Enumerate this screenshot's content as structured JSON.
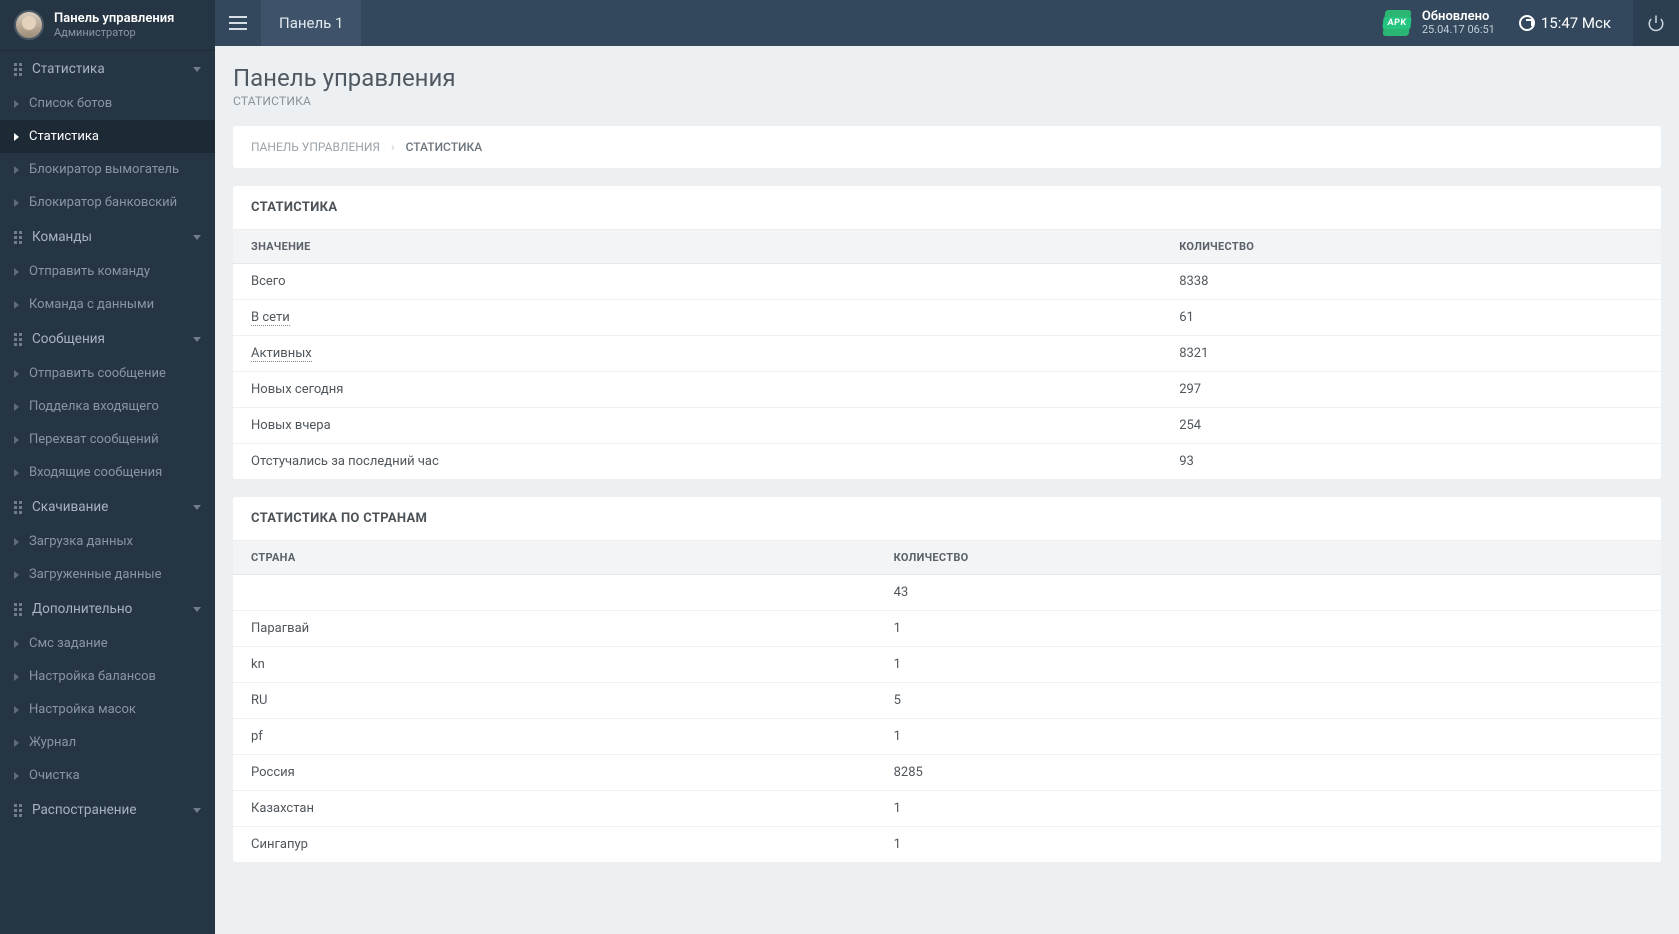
{
  "user": {
    "title": "Панель управления",
    "role": "Администратор"
  },
  "sidebar": {
    "statistics": {
      "header": "Статистика",
      "items": [
        "Список ботов",
        "Статистика",
        "Блокиратор вымогатель",
        "Блокиратор банковский"
      ],
      "active_index": 1
    },
    "commands": {
      "header": "Команды",
      "items": [
        "Отправить команду",
        "Команда с данными"
      ]
    },
    "messages": {
      "header": "Сообщения",
      "items": [
        "Отправить сообщение",
        "Подделка входящего",
        "Перехват сообщений",
        "Входящие сообщения"
      ]
    },
    "download": {
      "header": "Скачивание",
      "items": [
        "Загрузка данных",
        "Загруженные данные"
      ]
    },
    "extra": {
      "header": "Дополнительно",
      "items": [
        "Смс задание",
        "Настройка балансов",
        "Настройка масок",
        "Журнал",
        "Очистка"
      ]
    },
    "spread": {
      "header": "Распостранение"
    }
  },
  "topbar": {
    "tab": "Панель 1",
    "apk": "APK",
    "updated_label": "Обновлено",
    "updated_time": "25.04.17 06:51",
    "clock": "15:47 Мск"
  },
  "page": {
    "title": "Панель управления",
    "subtitle": "СТАТИСТИКА",
    "crumb_root": "ПАНЕЛЬ УПРАВЛЕНИЯ",
    "crumb_current": "СТАТИСТИКА"
  },
  "stats_panel": {
    "title": "СТАТИСТИКА",
    "col_value": "ЗНАЧЕНИЕ",
    "col_count": "КОЛИЧЕСТВО",
    "rows": [
      {
        "label": "Всего",
        "count": "8338",
        "dotted": false
      },
      {
        "label": "В сети",
        "count": "61",
        "dotted": true
      },
      {
        "label": "Активных",
        "count": "8321",
        "dotted": true
      },
      {
        "label": "Новых сегодня",
        "count": "297",
        "dotted": false
      },
      {
        "label": "Новых вчера",
        "count": "254",
        "dotted": false
      },
      {
        "label": "Отстучались за последний час",
        "count": "93",
        "dotted": false
      }
    ]
  },
  "country_panel": {
    "title": "СТАТИСТИКА ПО СТРАНАМ",
    "col_country": "СТРАНА",
    "col_count": "КОЛИЧЕСТВО",
    "rows": [
      {
        "label": "",
        "count": "43"
      },
      {
        "label": "Парагвай",
        "count": "1"
      },
      {
        "label": "kn",
        "count": "1"
      },
      {
        "label": "RU",
        "count": "5"
      },
      {
        "label": "pf",
        "count": "1"
      },
      {
        "label": "Россия",
        "count": "8285"
      },
      {
        "label": "Казахстан",
        "count": "1"
      },
      {
        "label": "Сингапур",
        "count": "1"
      }
    ]
  }
}
